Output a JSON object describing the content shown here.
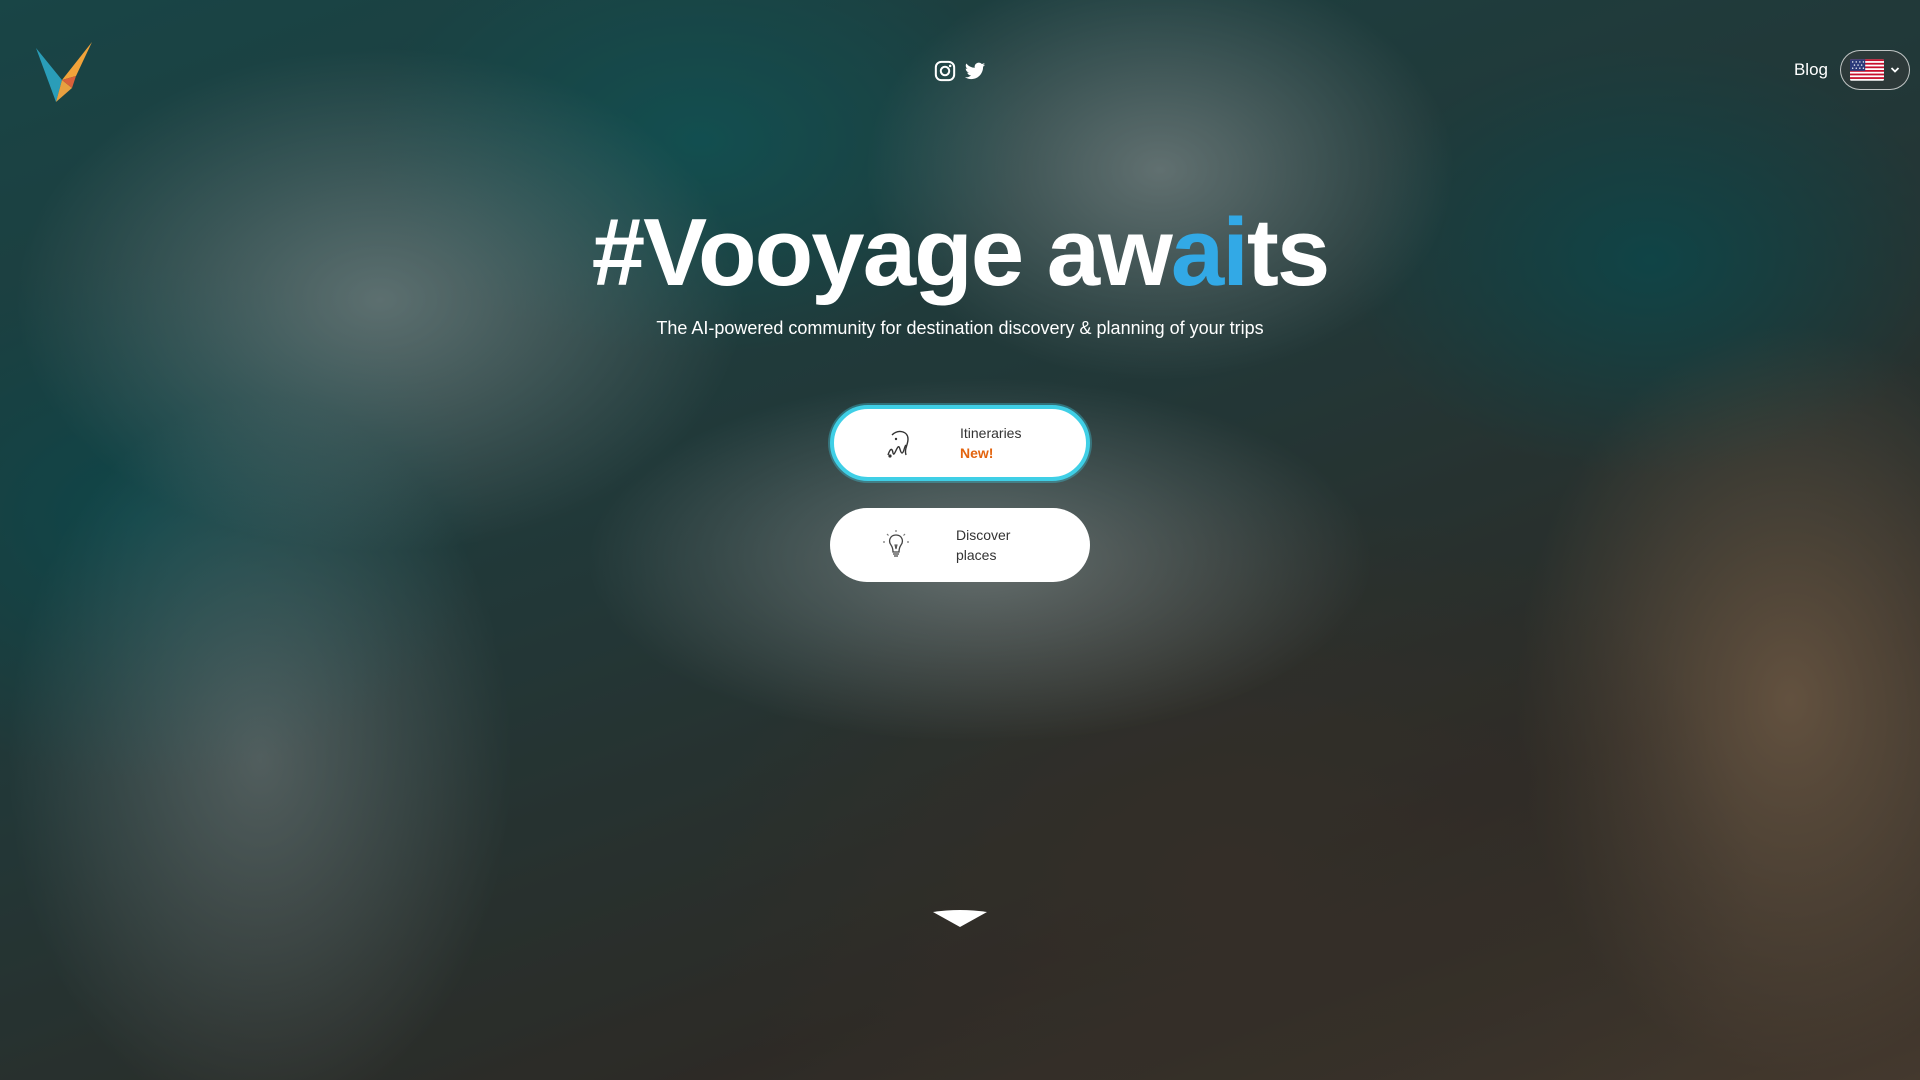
{
  "header": {
    "logo_icon": "voooyage-bird-logo",
    "social": [
      {
        "name": "instagram-icon"
      },
      {
        "name": "twitter-icon"
      }
    ],
    "blog_label": "Blog",
    "language": {
      "selected": "en-US",
      "flag_icon": "us-flag-icon"
    }
  },
  "hero": {
    "title_part1": "#Vooyage aw",
    "title_accent": "ai",
    "title_part2": "ts",
    "subtitle": "The AI-powered community for destination discovery & planning of your trips"
  },
  "actions": {
    "itineraries": {
      "label": "Itineraries",
      "badge": "New!",
      "icon": "itinerary-sketch-icon"
    },
    "discover": {
      "label_line1": "Discover",
      "label_line2": "places",
      "icon": "lightbulb-icon"
    }
  },
  "scroll_icon": "chevron-down-icon",
  "colors": {
    "accent_blue": "#32a9e6",
    "highlight_border": "#3fcfe6",
    "badge_orange": "#e3640f"
  }
}
